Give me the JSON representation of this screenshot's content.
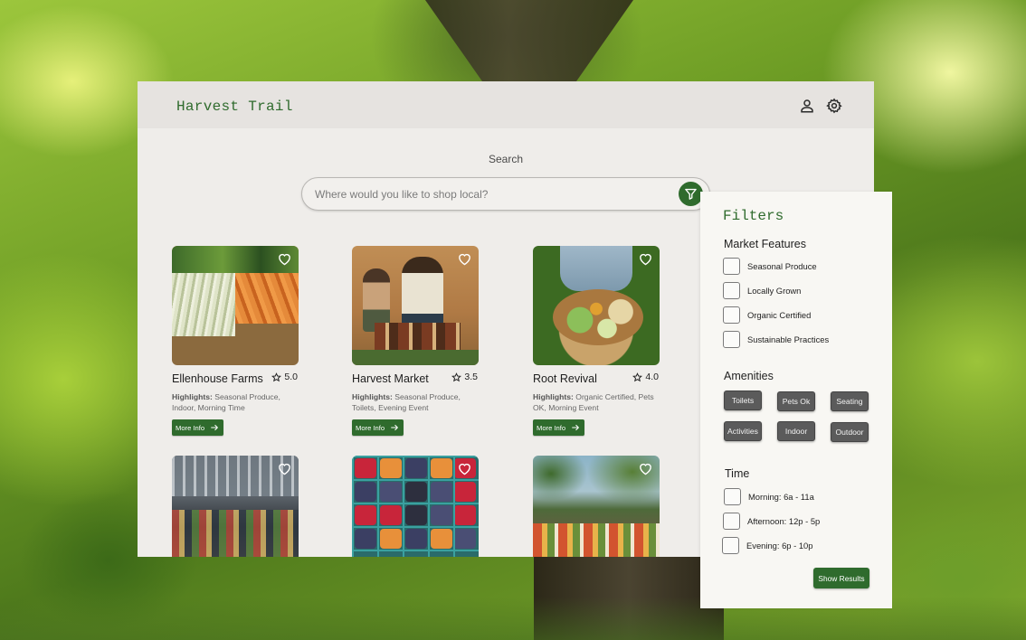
{
  "app": {
    "brand": "Harvest Trail"
  },
  "search": {
    "label": "Search",
    "placeholder": "Where would you like to shop local?"
  },
  "cards": [
    {
      "name": "Ellenhouse Farms",
      "rating": "5.0",
      "highlights_label": "Highlights:",
      "highlights": "Seasonal Produce, Indoor, Morning Time",
      "more_label": "More Info"
    },
    {
      "name": "Harvest Market",
      "rating": "3.5",
      "highlights_label": "Highlights:",
      "highlights": "Seasonal Produce, Toilets, Evening Event",
      "more_label": "More Info"
    },
    {
      "name": "Root Revival",
      "rating": "4.0",
      "highlights_label": "Highlights:",
      "highlights": "Organic Certified, Pets OK, Morning Event",
      "more_label": "More Info"
    }
  ],
  "filters": {
    "title": "Filters",
    "market_features": {
      "title": "Market Features",
      "items": [
        "Seasonal Produce",
        "Locally Grown",
        "Organic Certified",
        "Sustainable Practices"
      ]
    },
    "amenities": {
      "title": "Amenities",
      "chips": [
        "Toilets",
        "Pets Ok",
        "Seating",
        "Activities",
        "Indoor",
        "Outdoor"
      ]
    },
    "time": {
      "title": "Time",
      "items": [
        "Morning: 6a - 11a",
        "Afternoon: 12p - 5p",
        "Evening: 6p - 10p"
      ]
    },
    "show_results_label": "Show Results"
  },
  "colors": {
    "brand_green": "#2f6b2d",
    "chip_gray": "#5b5b5b",
    "window_bg": "#efedea",
    "header_bg": "#e6e3e0"
  },
  "icons": {
    "profile": "person-icon",
    "settings": "gear-icon",
    "filter": "filter-icon",
    "favorite": "heart-icon",
    "rating": "star-icon",
    "arrow": "arrow-right-icon"
  }
}
